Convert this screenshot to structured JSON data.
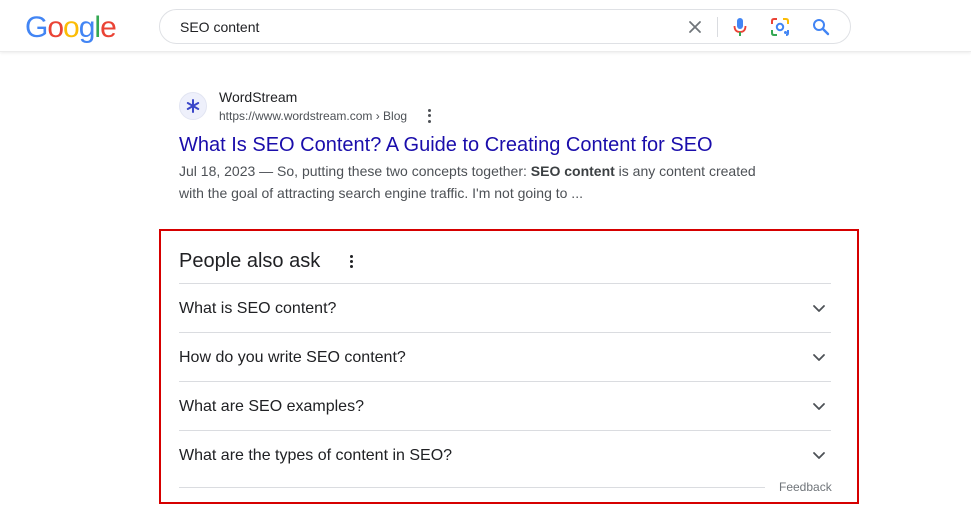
{
  "header": {
    "logo_letters": [
      {
        "char": "G",
        "color": "#4285F4"
      },
      {
        "char": "o",
        "color": "#EA4335"
      },
      {
        "char": "o",
        "color": "#FBBC05"
      },
      {
        "char": "g",
        "color": "#4285F4"
      },
      {
        "char": "l",
        "color": "#34A853"
      },
      {
        "char": "e",
        "color": "#EA4335"
      }
    ],
    "search": {
      "value": "SEO content",
      "icons": [
        "close-icon",
        "microphone-icon",
        "lens-icon",
        "search-icon"
      ]
    }
  },
  "result": {
    "favicon": "wordstream-icon",
    "site_name": "WordStream",
    "url": "https://www.wordstream.com › Blog",
    "title": "What Is SEO Content? A Guide to Creating Content for SEO",
    "snippet_pre": "Jul 18, 2023 — So, putting these two concepts together: ",
    "snippet_bold": "SEO content",
    "snippet_post": " is any content created with the goal of attracting search engine traffic. I'm not going to ..."
  },
  "people_also_ask": {
    "title": "People also ask",
    "questions": [
      "What is SEO content?",
      "How do you write SEO content?",
      "What are SEO examples?",
      "What are the types of content in SEO?"
    ],
    "feedback": "Feedback"
  },
  "colors": {
    "link": "#1a0dab",
    "highlight_border": "#d60000",
    "text": "#202124",
    "secondary_text": "#4d5156"
  }
}
